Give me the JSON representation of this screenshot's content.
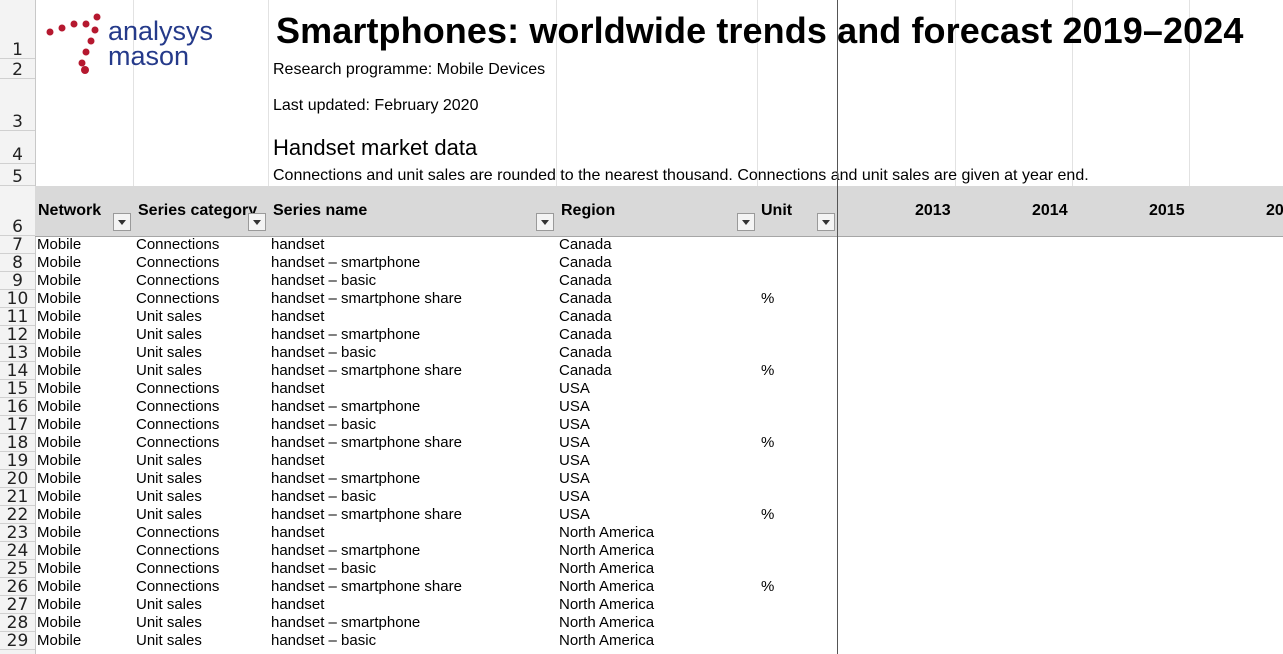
{
  "logo": {
    "line1": "analysys",
    "line2": "mason",
    "color": "#253a8a",
    "dot_color": "#b5182f"
  },
  "title": "Smartphones: worldwide trends and forecast 2019–2024",
  "research_programme": "Research programme: Mobile Devices",
  "last_updated": "Last updated: February 2020",
  "section_title": "Handset market data",
  "note": "Connections and unit sales are rounded to the nearest thousand. Connections and unit sales are given at year end.",
  "columns": {
    "network": "Network",
    "series_category": "Series category",
    "series_name": "Series name",
    "region": "Region",
    "unit": "Unit",
    "years": [
      "2013",
      "2014",
      "2015",
      "20"
    ]
  },
  "row_numbers": [
    "1",
    "2",
    "3",
    "4",
    "5",
    "6",
    "7",
    "8",
    "9",
    "10",
    "11",
    "12",
    "13",
    "14",
    "15",
    "16",
    "17",
    "18",
    "19",
    "20",
    "21",
    "22",
    "23",
    "24",
    "25",
    "26",
    "27",
    "28",
    "29"
  ],
  "rows": [
    {
      "network": "Mobile",
      "category": "Connections",
      "name": "handset",
      "region": "Canada",
      "unit": ""
    },
    {
      "network": "Mobile",
      "category": "Connections",
      "name": "handset – smartphone",
      "region": "Canada",
      "unit": ""
    },
    {
      "network": "Mobile",
      "category": "Connections",
      "name": "handset – basic",
      "region": "Canada",
      "unit": ""
    },
    {
      "network": "Mobile",
      "category": "Connections",
      "name": "handset – smartphone share",
      "region": "Canada",
      "unit": "%"
    },
    {
      "network": "Mobile",
      "category": "Unit sales",
      "name": "handset",
      "region": "Canada",
      "unit": ""
    },
    {
      "network": "Mobile",
      "category": "Unit sales",
      "name": "handset – smartphone",
      "region": "Canada",
      "unit": ""
    },
    {
      "network": "Mobile",
      "category": "Unit sales",
      "name": "handset – basic",
      "region": "Canada",
      "unit": ""
    },
    {
      "network": "Mobile",
      "category": "Unit sales",
      "name": "handset – smartphone share",
      "region": "Canada",
      "unit": "%"
    },
    {
      "network": "Mobile",
      "category": "Connections",
      "name": "handset",
      "region": "USA",
      "unit": ""
    },
    {
      "network": "Mobile",
      "category": "Connections",
      "name": "handset – smartphone",
      "region": "USA",
      "unit": ""
    },
    {
      "network": "Mobile",
      "category": "Connections",
      "name": "handset – basic",
      "region": "USA",
      "unit": ""
    },
    {
      "network": "Mobile",
      "category": "Connections",
      "name": "handset – smartphone share",
      "region": "USA",
      "unit": "%"
    },
    {
      "network": "Mobile",
      "category": "Unit sales",
      "name": "handset",
      "region": "USA",
      "unit": ""
    },
    {
      "network": "Mobile",
      "category": "Unit sales",
      "name": "handset – smartphone",
      "region": "USA",
      "unit": ""
    },
    {
      "network": "Mobile",
      "category": "Unit sales",
      "name": "handset – basic",
      "region": "USA",
      "unit": ""
    },
    {
      "network": "Mobile",
      "category": "Unit sales",
      "name": "handset – smartphone share",
      "region": "USA",
      "unit": "%"
    },
    {
      "network": "Mobile",
      "category": "Connections",
      "name": "handset",
      "region": "North America",
      "unit": ""
    },
    {
      "network": "Mobile",
      "category": "Connections",
      "name": "handset – smartphone",
      "region": "North America",
      "unit": ""
    },
    {
      "network": "Mobile",
      "category": "Connections",
      "name": "handset – basic",
      "region": "North America",
      "unit": ""
    },
    {
      "network": "Mobile",
      "category": "Connections",
      "name": "handset – smartphone share",
      "region": "North America",
      "unit": "%"
    },
    {
      "network": "Mobile",
      "category": "Unit sales",
      "name": "handset",
      "region": "North America",
      "unit": ""
    },
    {
      "network": "Mobile",
      "category": "Unit sales",
      "name": "handset – smartphone",
      "region": "North America",
      "unit": ""
    },
    {
      "network": "Mobile",
      "category": "Unit sales",
      "name": "handset – basic",
      "region": "North America",
      "unit": ""
    }
  ]
}
